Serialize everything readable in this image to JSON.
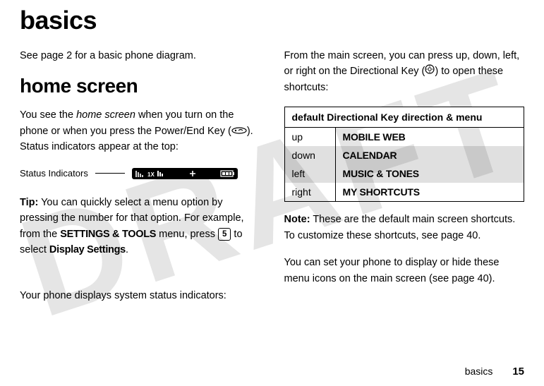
{
  "watermark": "DRAFT",
  "title": "basics",
  "left": {
    "intro": "See page 2 for a basic phone diagram.",
    "section_heading": "home screen",
    "home_p1_a": "You see the ",
    "home_p1_italic": "home screen",
    "home_p1_b": " when you turn on the phone or when you press the Power/End Key (",
    "home_p1_c": "). Status indicators appear at the top:",
    "status_label": "Status Indicators",
    "tip_label": "Tip:",
    "tip_a": " You can quickly select a menu option by pressing the number for that option. For example, from the ",
    "tip_menu": "SETTINGS & TOOLS",
    "tip_b": " menu, press ",
    "tip_key": "5",
    "tip_c": " to select ",
    "tip_target": "Display Settings",
    "tip_d": ".",
    "sys_status": "Your phone displays system status indicators:"
  },
  "right": {
    "intro_a": "From the main screen, you can press up, down, left, or right on the Directional Key (",
    "intro_b": ") to open these shortcuts:",
    "table_header": "default Directional Key direction & menu",
    "rows": [
      {
        "dir": "up",
        "val": "MOBILE WEB"
      },
      {
        "dir": "down",
        "val": "CALENDAR"
      },
      {
        "dir": "left",
        "val": "MUSIC & TONES"
      },
      {
        "dir": "right",
        "val": "MY SHORTCUTS"
      }
    ],
    "note_label": "Note:",
    "note_text": " These are the default main screen shortcuts. To customize these shortcuts, see page 40.",
    "icons_text": "You can set your phone to display or hide these menu icons on the main screen (see page 40)."
  },
  "footer": {
    "section": "basics",
    "page": "15"
  }
}
